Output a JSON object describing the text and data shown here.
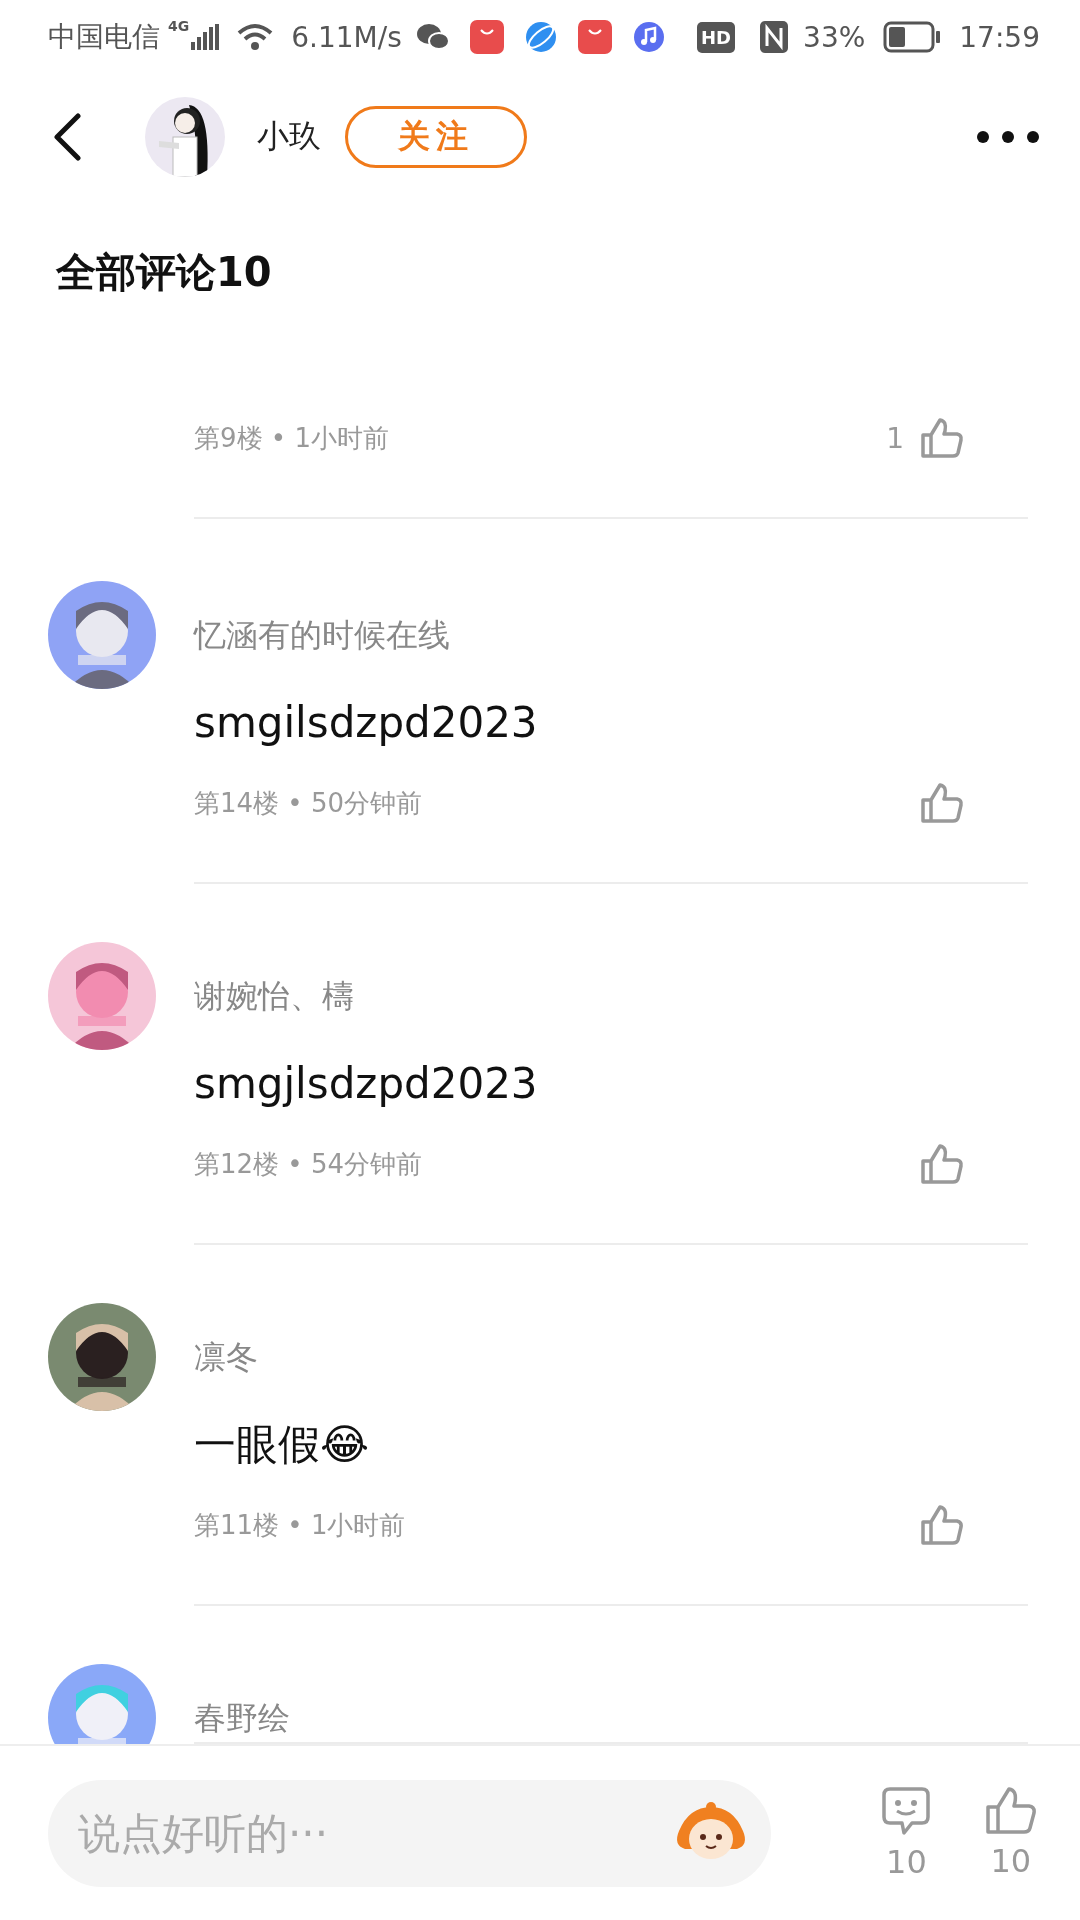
{
  "status_bar": {
    "carrier": "中国电信",
    "network": "4G",
    "speed": "6.11M/s",
    "hd": "HD",
    "battery": "33%",
    "time": "17:59"
  },
  "header": {
    "name": "小玖",
    "follow": "关注"
  },
  "title": "全部评论10",
  "comments": [
    {
      "meta": "第9楼 • 1小时前",
      "likes": "1"
    },
    {
      "name": "忆涵有的时候在线",
      "text": "smgilsdzpd2023",
      "meta": "第14楼 • 50分钟前"
    },
    {
      "name": "谢婉怡、檮",
      "text": "smgjlsdzpd2023",
      "meta": "第12楼 • 54分钟前"
    },
    {
      "name": "凛冬",
      "text": "一眼假😂",
      "meta": "第11楼 • 1小时前"
    },
    {
      "name": "春野绘"
    }
  ],
  "composer": {
    "placeholder": "说点好听的···",
    "comments": "10",
    "likes": "10"
  }
}
